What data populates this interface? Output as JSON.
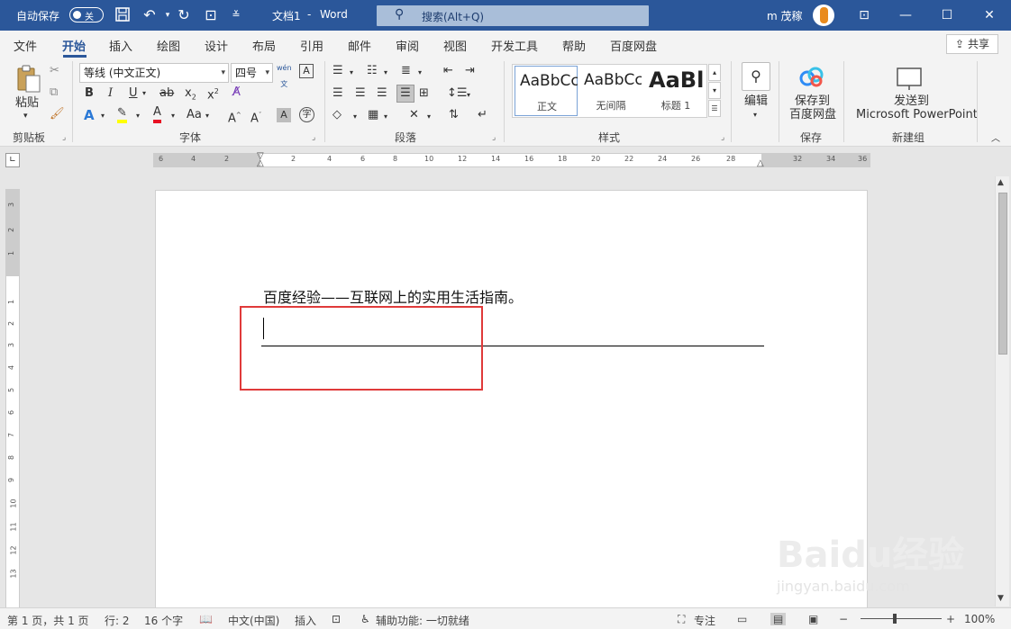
{
  "titlebar": {
    "autosave_label": "自动保存",
    "autosave_state": "关",
    "doc_title": "文档1",
    "separator": "-",
    "app_name": "Word",
    "search_placeholder": "搜索(Alt+Q)",
    "user_name": "m 茂稼"
  },
  "ribbon_tabs": [
    "文件",
    "开始",
    "插入",
    "绘图",
    "设计",
    "布局",
    "引用",
    "邮件",
    "审阅",
    "视图",
    "开发工具",
    "帮助",
    "百度网盘"
  ],
  "share_label": "共享",
  "clipboard": {
    "paste": "粘贴",
    "group": "剪贴板"
  },
  "font": {
    "name": "等线 (中文正文)",
    "size": "四号",
    "wen": "wén",
    "wen2": "文",
    "group": "字体"
  },
  "paragraph": {
    "group": "段落"
  },
  "styles": {
    "group": "样式",
    "items": [
      {
        "preview": "AaBbCcD",
        "name": "正文"
      },
      {
        "preview": "AaBbCcD",
        "name": "无间隔"
      },
      {
        "preview": "AaBl",
        "name": "标题 1"
      }
    ]
  },
  "editing": {
    "label": "编辑"
  },
  "save": {
    "line1": "保存到",
    "line2": "百度网盘",
    "group": "保存"
  },
  "newgroup": {
    "line1": "发送到",
    "line2": "Microsoft PowerPoint",
    "group": "新建组"
  },
  "ruler_numbers": [
    "6",
    "4",
    "2",
    "2",
    "4",
    "6",
    "8",
    "10",
    "12",
    "14",
    "16",
    "18",
    "20",
    "22",
    "24",
    "26",
    "28",
    "32",
    "34",
    "36"
  ],
  "vruler_numbers": [
    "3",
    "2",
    "1",
    "1",
    "2",
    "3",
    "4",
    "5",
    "6",
    "7",
    "8",
    "9",
    "10",
    "11",
    "12",
    "13"
  ],
  "document": {
    "text": "百度经验——互联网上的实用生活指南。"
  },
  "status": {
    "page": "第 1 页，共 1 页",
    "line": "行: 2",
    "words": "16 个字",
    "lang": "中文(中国)",
    "mode": "插入",
    "accessibility": "辅助功能: 一切就绪",
    "focus": "专注",
    "zoom": "100%"
  },
  "watermark": {
    "brand": "Baidu经验",
    "url": "jingyan.baidu.com"
  },
  "colors": {
    "accent": "#2b579a",
    "highlight": "#ffff00",
    "font_color": "#e81123",
    "annot": "#e03a3a"
  }
}
